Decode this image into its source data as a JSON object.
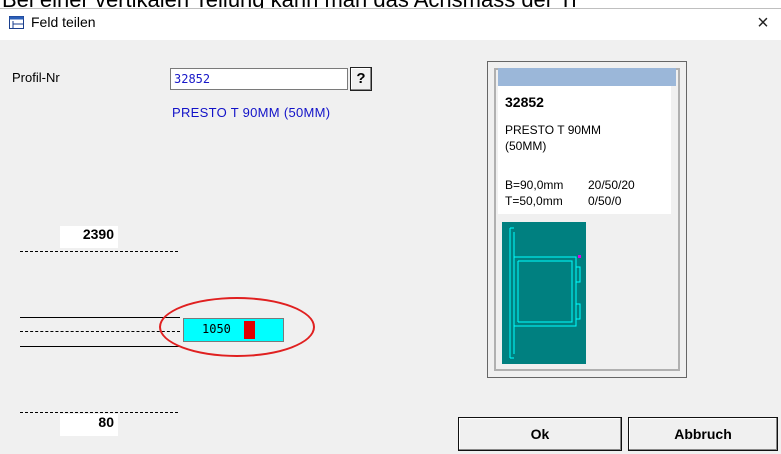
{
  "top_text": "Bei einer vertikalen Teilung kann man das Achsmass der Tr",
  "window": {
    "title": "Feld teilen",
    "close_glyph": "×"
  },
  "form": {
    "profil_label": "Profil-Nr",
    "profil_value": "32852",
    "help_glyph": "?",
    "profil_description": "PRESTO T 90MM (50MM)"
  },
  "dimensions": {
    "top": "2390",
    "bottom": "80",
    "field_value": "1050"
  },
  "preview": {
    "number": "32852",
    "name_line1": "PRESTO T 90MM",
    "name_line2": "(50MM)",
    "spec_b": "B=90,0mm",
    "spec_b_values": "20/50/20",
    "spec_t": "T=50,0mm",
    "spec_t_values": "0/50/0"
  },
  "buttons": {
    "ok": "Ok",
    "cancel": "Abbruch"
  },
  "colors": {
    "field_bg": "#00ffff",
    "profile_text": "#1212c8",
    "highlight_ellipse": "#e02020",
    "profile_graphic": "#008080"
  }
}
